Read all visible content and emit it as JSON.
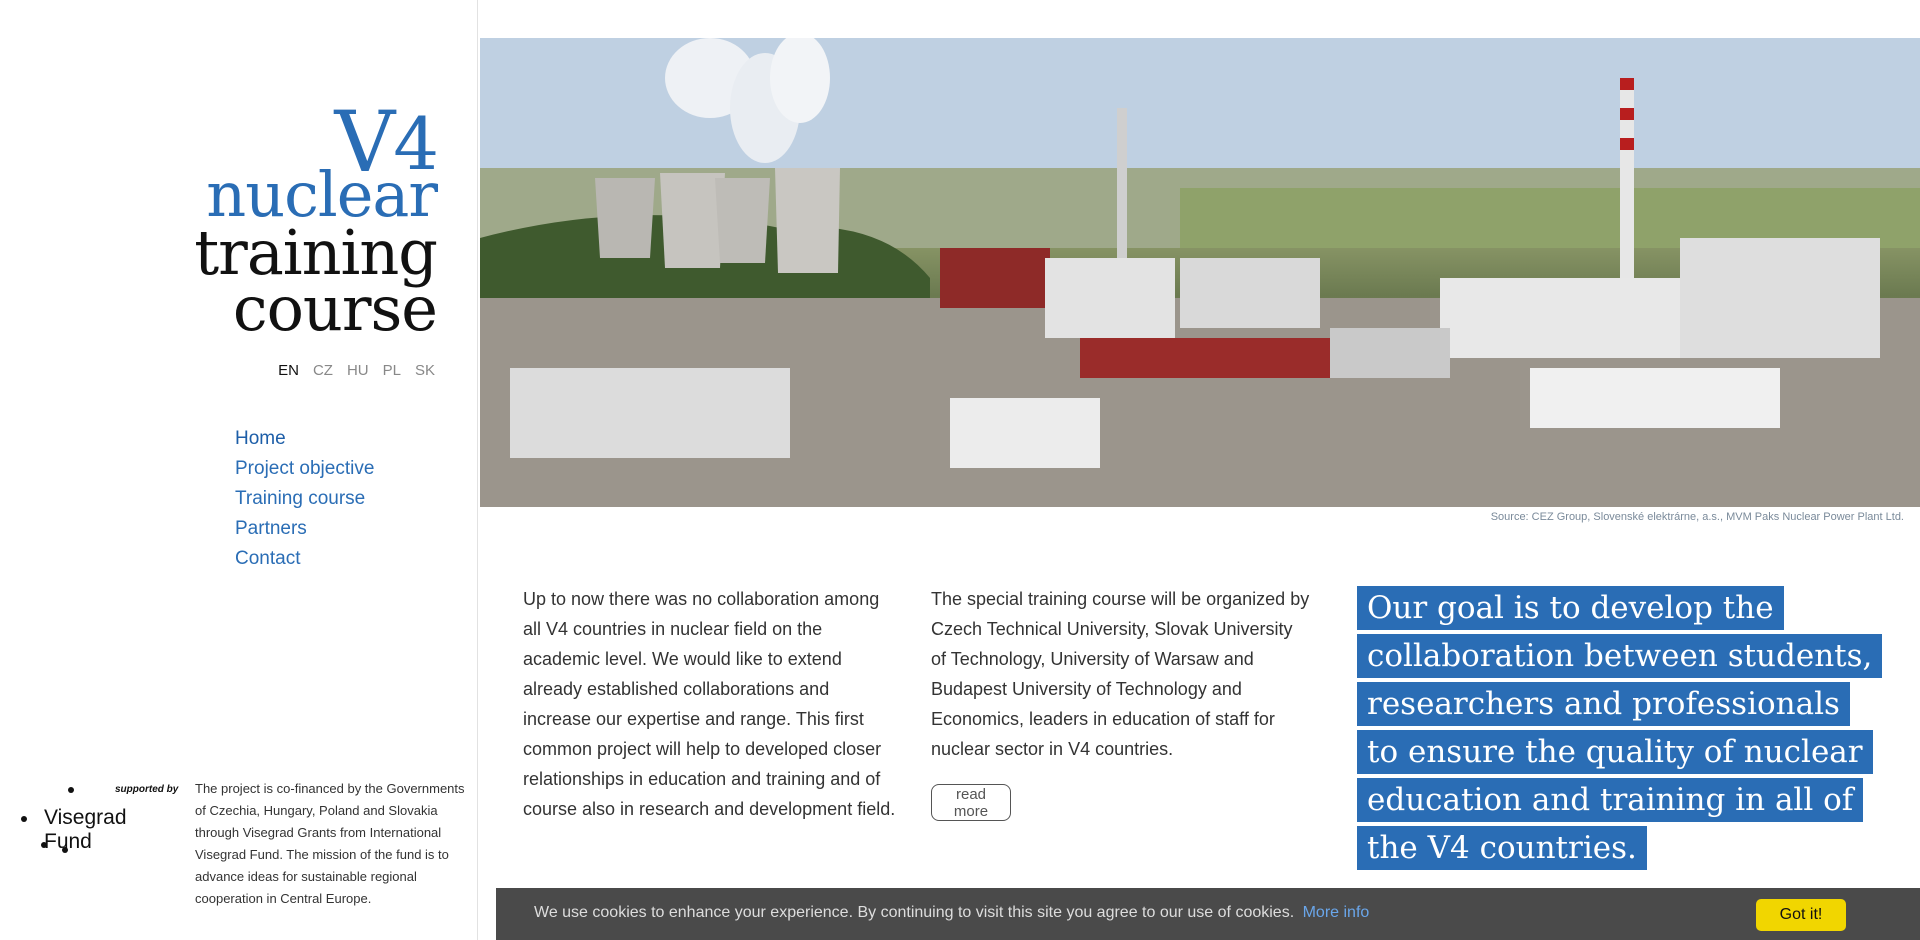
{
  "logo": {
    "v": "V",
    "four": "4",
    "line1": "nuclear",
    "line2": "training",
    "line3": "course"
  },
  "languages": [
    {
      "code": "EN",
      "active": true
    },
    {
      "code": "CZ",
      "active": false
    },
    {
      "code": "HU",
      "active": false
    },
    {
      "code": "PL",
      "active": false
    },
    {
      "code": "SK",
      "active": false
    }
  ],
  "nav": [
    {
      "label": "Home",
      "active": true
    },
    {
      "label": "Project objective",
      "active": false
    },
    {
      "label": "Training course",
      "active": false
    },
    {
      "label": "Partners",
      "active": false
    },
    {
      "label": "Contact",
      "active": false
    }
  ],
  "sponsor": {
    "supported_by": "supported by",
    "fund_name": "Visegrad Fund",
    "text": "The project is co-financed by the Governments of Czechia, Hungary, Poland and Slovakia through Visegrad Grants from International Visegrad Fund. The mission of the fund is to advance ideas for sustainable regional cooperation in Central Europe."
  },
  "hero": {
    "caption": "Source: CEZ Group, Slovenské elektrárne, a.s., MVM Paks Nuclear Power Plant Ltd."
  },
  "content": {
    "col1": "Up to now there was no collaboration among all V4 countries in nuclear field on the academic level. We would like to extend already established collaborations and increase our expertise and range. This first common project will help to developed closer relationships in education and training and of course also in research and development field.",
    "col2": "The special training course will be organized by Czech Technical University, Slovak University of Technology, University of Warsaw and Budapest University of Technology and Economics, leaders in education of staff for nuclear sector in V4 countries.",
    "read_more": "read more",
    "goal": "Our goal is to develop the collaboration between students, researchers and professionals to ensure the quality of nuclear education and training in all of the V4 countries."
  },
  "cookie": {
    "message": "We use cookies to enhance your experience. By continuing to visit this site you agree to our use of cookies.",
    "more_info": "More info",
    "button": "Got it!"
  },
  "colors": {
    "brand_blue": "#2a6db5",
    "cookie_bg": "#4a4a4a",
    "cookie_button": "#f1d600"
  }
}
